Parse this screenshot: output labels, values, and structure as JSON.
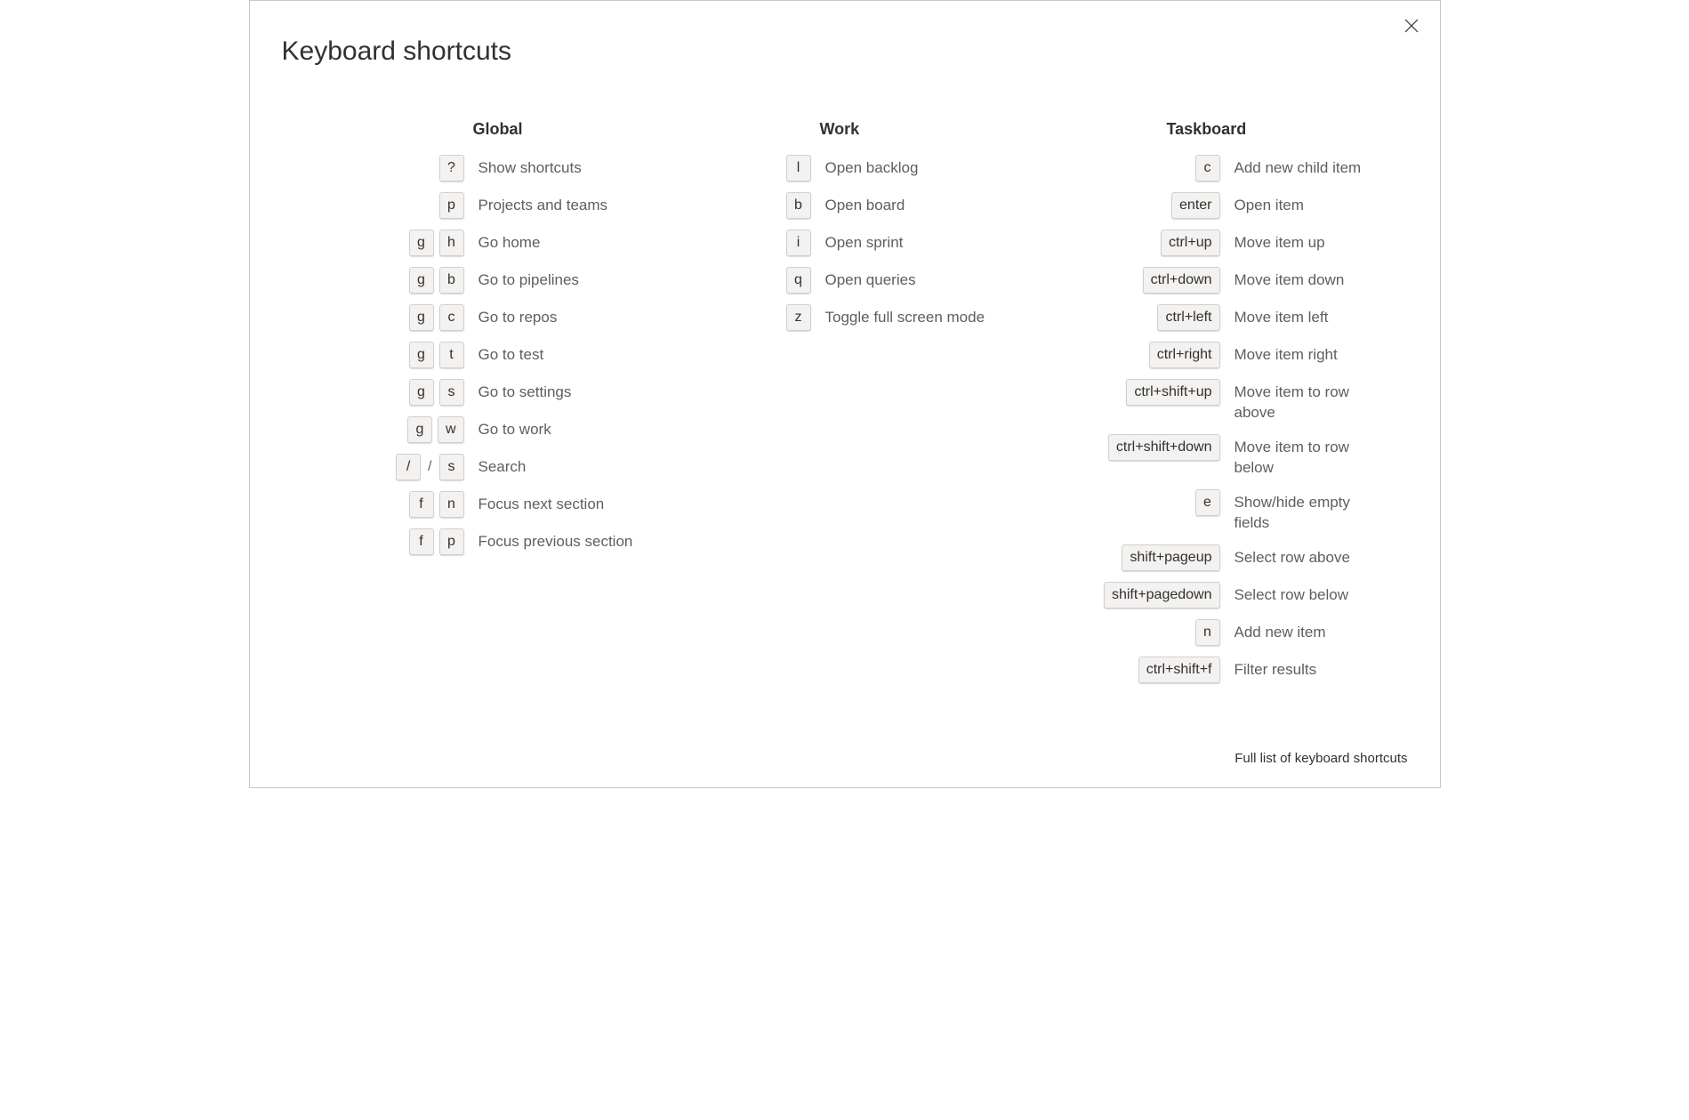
{
  "title": "Keyboard shortcuts",
  "footer_link": "Full list of keyboard shortcuts",
  "columns": {
    "global": {
      "header": "Global",
      "rows": [
        {
          "keys": [
            "?"
          ],
          "desc": "Show shortcuts"
        },
        {
          "keys": [
            "p"
          ],
          "desc": "Projects and teams"
        },
        {
          "keys": [
            "g",
            "h"
          ],
          "desc": "Go home"
        },
        {
          "keys": [
            "g",
            "b"
          ],
          "desc": "Go to pipelines"
        },
        {
          "keys": [
            "g",
            "c"
          ],
          "desc": "Go to repos"
        },
        {
          "keys": [
            "g",
            "t"
          ],
          "desc": "Go to test"
        },
        {
          "keys": [
            "g",
            "s"
          ],
          "desc": "Go to settings"
        },
        {
          "keys": [
            "g",
            "w"
          ],
          "desc": "Go to work"
        },
        {
          "keys": [
            "/",
            "s"
          ],
          "sep": "/",
          "desc": "Search"
        },
        {
          "keys": [
            "f",
            "n"
          ],
          "desc": "Focus next section"
        },
        {
          "keys": [
            "f",
            "p"
          ],
          "desc": "Focus previous section"
        }
      ]
    },
    "work": {
      "header": "Work",
      "rows": [
        {
          "keys": [
            "l"
          ],
          "desc": "Open backlog"
        },
        {
          "keys": [
            "b"
          ],
          "desc": "Open board"
        },
        {
          "keys": [
            "i"
          ],
          "desc": "Open sprint"
        },
        {
          "keys": [
            "q"
          ],
          "desc": "Open queries"
        },
        {
          "keys": [
            "z"
          ],
          "desc": "Toggle full screen mode"
        }
      ]
    },
    "taskboard": {
      "header": "Taskboard",
      "rows": [
        {
          "keys": [
            "c"
          ],
          "desc": "Add new child item"
        },
        {
          "keys": [
            "enter"
          ],
          "desc": "Open item"
        },
        {
          "keys": [
            "ctrl+up"
          ],
          "desc": "Move item up"
        },
        {
          "keys": [
            "ctrl+down"
          ],
          "desc": "Move item down"
        },
        {
          "keys": [
            "ctrl+left"
          ],
          "desc": "Move item left"
        },
        {
          "keys": [
            "ctrl+right"
          ],
          "desc": "Move item right"
        },
        {
          "keys": [
            "ctrl+shift+up"
          ],
          "desc": "Move item to row above"
        },
        {
          "keys": [
            "ctrl+shift+down"
          ],
          "desc": "Move item to row below"
        },
        {
          "keys": [
            "e"
          ],
          "desc": "Show/hide empty fields"
        },
        {
          "keys": [
            "shift+pageup"
          ],
          "desc": "Select row above"
        },
        {
          "keys": [
            "shift+pagedown"
          ],
          "desc": "Select row below"
        },
        {
          "keys": [
            "n"
          ],
          "desc": "Add new item"
        },
        {
          "keys": [
            "ctrl+shift+f"
          ],
          "desc": "Filter results"
        }
      ]
    }
  }
}
